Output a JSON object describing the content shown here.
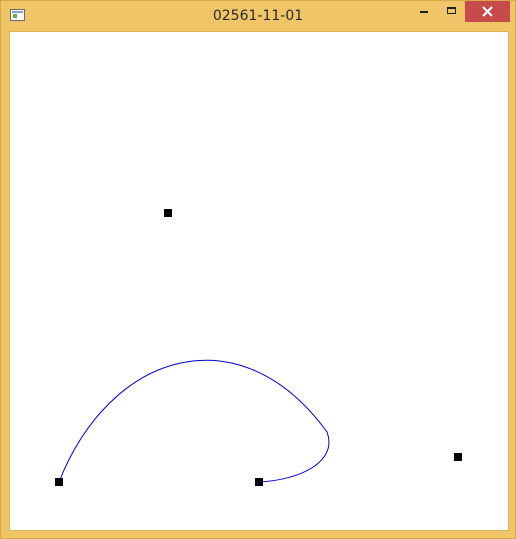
{
  "window": {
    "title": "02561-11-01"
  },
  "icons": {
    "app": "window-app-icon",
    "minimize": "minimize-icon",
    "maximize": "maximize-icon",
    "close": "close-icon"
  },
  "colors": {
    "titlebar": "#f0c567",
    "close_button": "#c74b4b",
    "curve": "#0000cc",
    "control_point": "#000000"
  }
}
